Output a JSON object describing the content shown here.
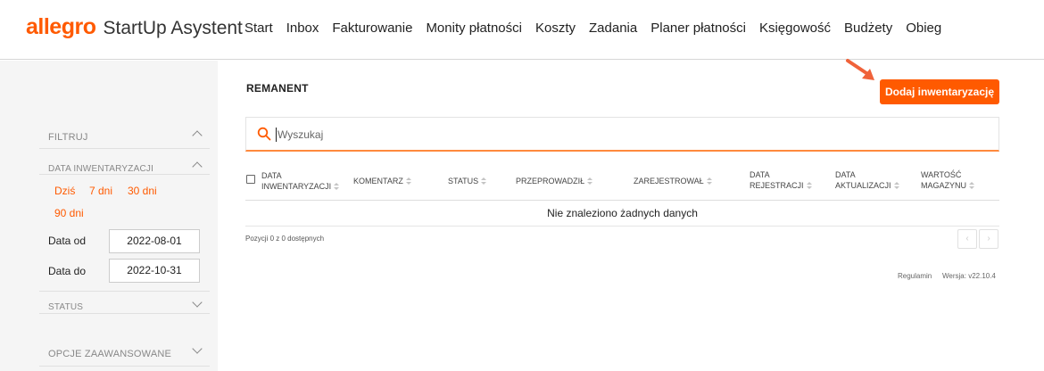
{
  "header": {
    "logo": "allegro",
    "app_name": "StartUp Asystent",
    "nav": [
      "Start",
      "Inbox",
      "Fakturowanie",
      "Monity płatności",
      "Koszty",
      "Zadania",
      "Planer płatności",
      "Księgowość",
      "Budżety",
      "Obieg"
    ]
  },
  "sidebar": {
    "filter_title": "FILTRUJ",
    "date_section_title": "DATA INWENTARYZACJI",
    "quick_ranges": [
      "Dziś",
      "7 dni",
      "30 dni",
      "90 dni"
    ],
    "date_from_label": "Data od",
    "date_from_value": "2022-08-01",
    "date_to_label": "Data do",
    "date_to_value": "2022-10-31",
    "status_title": "STATUS",
    "advanced_title": "OPCJE ZAAWANSOWANE"
  },
  "main": {
    "title": "REMANENT",
    "add_button": "Dodaj inwentaryzację",
    "search_placeholder": "Wyszukaj",
    "columns": [
      {
        "l1": "DATA",
        "l2": "INWENTARYZACJI"
      },
      {
        "l1": "",
        "l2": "KOMENTARZ"
      },
      {
        "l1": "",
        "l2": "STATUS"
      },
      {
        "l1": "",
        "l2": "PRZEPROWADZIŁ"
      },
      {
        "l1": "",
        "l2": "ZAREJESTROWAŁ"
      },
      {
        "l1": "DATA",
        "l2": "REJESTRACJI"
      },
      {
        "l1": "DATA",
        "l2": "AKTUALIZACJI"
      },
      {
        "l1": "WARTOŚĆ",
        "l2": "MAGAZYNU"
      }
    ],
    "empty_text": "Nie znaleziono żadnych danych",
    "pagination_info": "Pozycji 0 z 0 dostępnych",
    "pager_prev": "‹",
    "pager_next": "›"
  },
  "footer": {
    "terms": "Regulamin",
    "version": "Wersja: v22.10.4"
  },
  "colors": {
    "accent": "#ff5a00",
    "sidebar_bg": "#f5f5f5"
  }
}
